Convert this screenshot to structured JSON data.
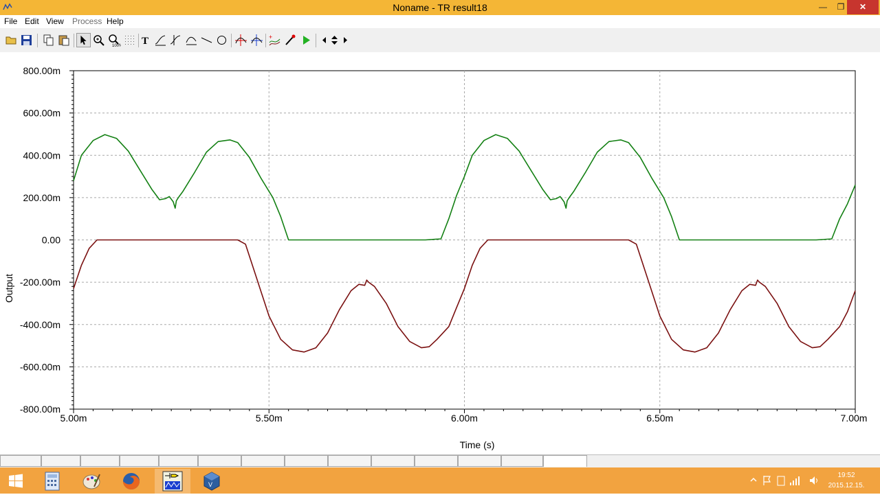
{
  "window": {
    "title": "Noname - TR result18"
  },
  "menu": {
    "file": "File",
    "edit": "Edit",
    "view": "View",
    "process": "Process",
    "help": "Help"
  },
  "toolbar": {
    "buttons": [
      "open-folder-icon",
      "save-icon",
      "copy-icon",
      "paste-icon",
      "pointer-icon",
      "zoom-in-icon",
      "zoom-100-icon",
      "grid-icon",
      "text-icon",
      "curve-tool-icon",
      "curve-tool-2-icon",
      "curve-tool-3-icon",
      "line-icon",
      "circle-icon",
      "cursor-a-icon",
      "cursor-b-icon",
      "add-curve-icon",
      "probe-icon",
      "run-icon",
      "scroll-left-icon",
      "scroll-updown-icon",
      "scroll-right-icon"
    ]
  },
  "chart_data": {
    "type": "line",
    "xlabel": "Time (s)",
    "ylabel": "Output",
    "xlim": [
      5.0,
      7.0
    ],
    "ylim": [
      -800,
      800
    ],
    "x_ticks": [
      "5.00m",
      "5.50m",
      "6.00m",
      "6.50m",
      "7.00m"
    ],
    "y_ticks": [
      "800.00m",
      "600.00m",
      "400.00m",
      "200.00m",
      "0.00",
      "-200.00m",
      "-400.00m",
      "-600.00m",
      "-800.00m"
    ],
    "grid": true,
    "series": [
      {
        "color": "#138013",
        "x": [
          5.0,
          5.02,
          5.05,
          5.08,
          5.11,
          5.14,
          5.17,
          5.2,
          5.22,
          5.235,
          5.245,
          5.255,
          5.26,
          5.263,
          5.268,
          5.28,
          5.31,
          5.34,
          5.37,
          5.4,
          5.42,
          5.45,
          5.48,
          5.51,
          5.53,
          5.55,
          5.6,
          5.7,
          5.8,
          5.9,
          5.94,
          5.96,
          5.98,
          6.0,
          6.02,
          6.05,
          6.08,
          6.11,
          6.14,
          6.17,
          6.2,
          6.22,
          6.235,
          6.245,
          6.255,
          6.26,
          6.263,
          6.268,
          6.28,
          6.31,
          6.34,
          6.37,
          6.4,
          6.42,
          6.45,
          6.48,
          6.51,
          6.53,
          6.55,
          6.6,
          6.7,
          6.8,
          6.9,
          6.94,
          6.96,
          6.98,
          7.0
        ],
        "y": [
          280,
          400,
          470,
          498,
          480,
          420,
          330,
          240,
          190,
          195,
          205,
          180,
          150,
          185,
          200,
          230,
          320,
          415,
          465,
          473,
          460,
          390,
          290,
          200,
          110,
          0,
          0,
          0,
          0,
          0,
          5,
          100,
          210,
          300,
          400,
          470,
          498,
          480,
          420,
          330,
          240,
          190,
          195,
          205,
          180,
          150,
          185,
          200,
          230,
          320,
          415,
          465,
          473,
          460,
          390,
          290,
          200,
          110,
          0,
          0,
          0,
          0,
          0,
          5,
          100,
          170,
          260
        ]
      },
      {
        "color": "#7a1010",
        "x": [
          5.0,
          5.02,
          5.04,
          5.06,
          5.1,
          5.2,
          5.3,
          5.4,
          5.42,
          5.44,
          5.47,
          5.5,
          5.53,
          5.56,
          5.59,
          5.62,
          5.65,
          5.68,
          5.71,
          5.73,
          5.745,
          5.75,
          5.755,
          5.77,
          5.8,
          5.83,
          5.86,
          5.89,
          5.91,
          5.93,
          5.96,
          5.98,
          6.0,
          6.02,
          6.04,
          6.06,
          6.1,
          6.2,
          6.3,
          6.4,
          6.42,
          6.44,
          6.47,
          6.5,
          6.53,
          6.56,
          6.59,
          6.62,
          6.65,
          6.68,
          6.71,
          6.73,
          6.745,
          6.75,
          6.755,
          6.77,
          6.8,
          6.83,
          6.86,
          6.89,
          6.91,
          6.93,
          6.96,
          6.98,
          7.0
        ],
        "y": [
          -230,
          -120,
          -40,
          0,
          0,
          0,
          0,
          0,
          0,
          -20,
          -190,
          -360,
          -470,
          -520,
          -530,
          -510,
          -440,
          -330,
          -240,
          -210,
          -215,
          -190,
          -200,
          -220,
          -300,
          -410,
          -480,
          -510,
          -505,
          -470,
          -410,
          -320,
          -230,
          -120,
          -40,
          0,
          0,
          0,
          0,
          0,
          0,
          -20,
          -190,
          -360,
          -470,
          -520,
          -530,
          -510,
          -440,
          -330,
          -240,
          -210,
          -215,
          -190,
          -200,
          -220,
          -300,
          -410,
          -480,
          -510,
          -505,
          -470,
          -410,
          -340,
          -240
        ]
      }
    ]
  },
  "taskbar": {
    "apps": [
      "start-icon",
      "calculator-icon",
      "paint-icon",
      "firefox-icon",
      "tina-icon",
      "virtualbox-icon"
    ],
    "clock_time": "19:52",
    "clock_date": "2015.12.15."
  }
}
